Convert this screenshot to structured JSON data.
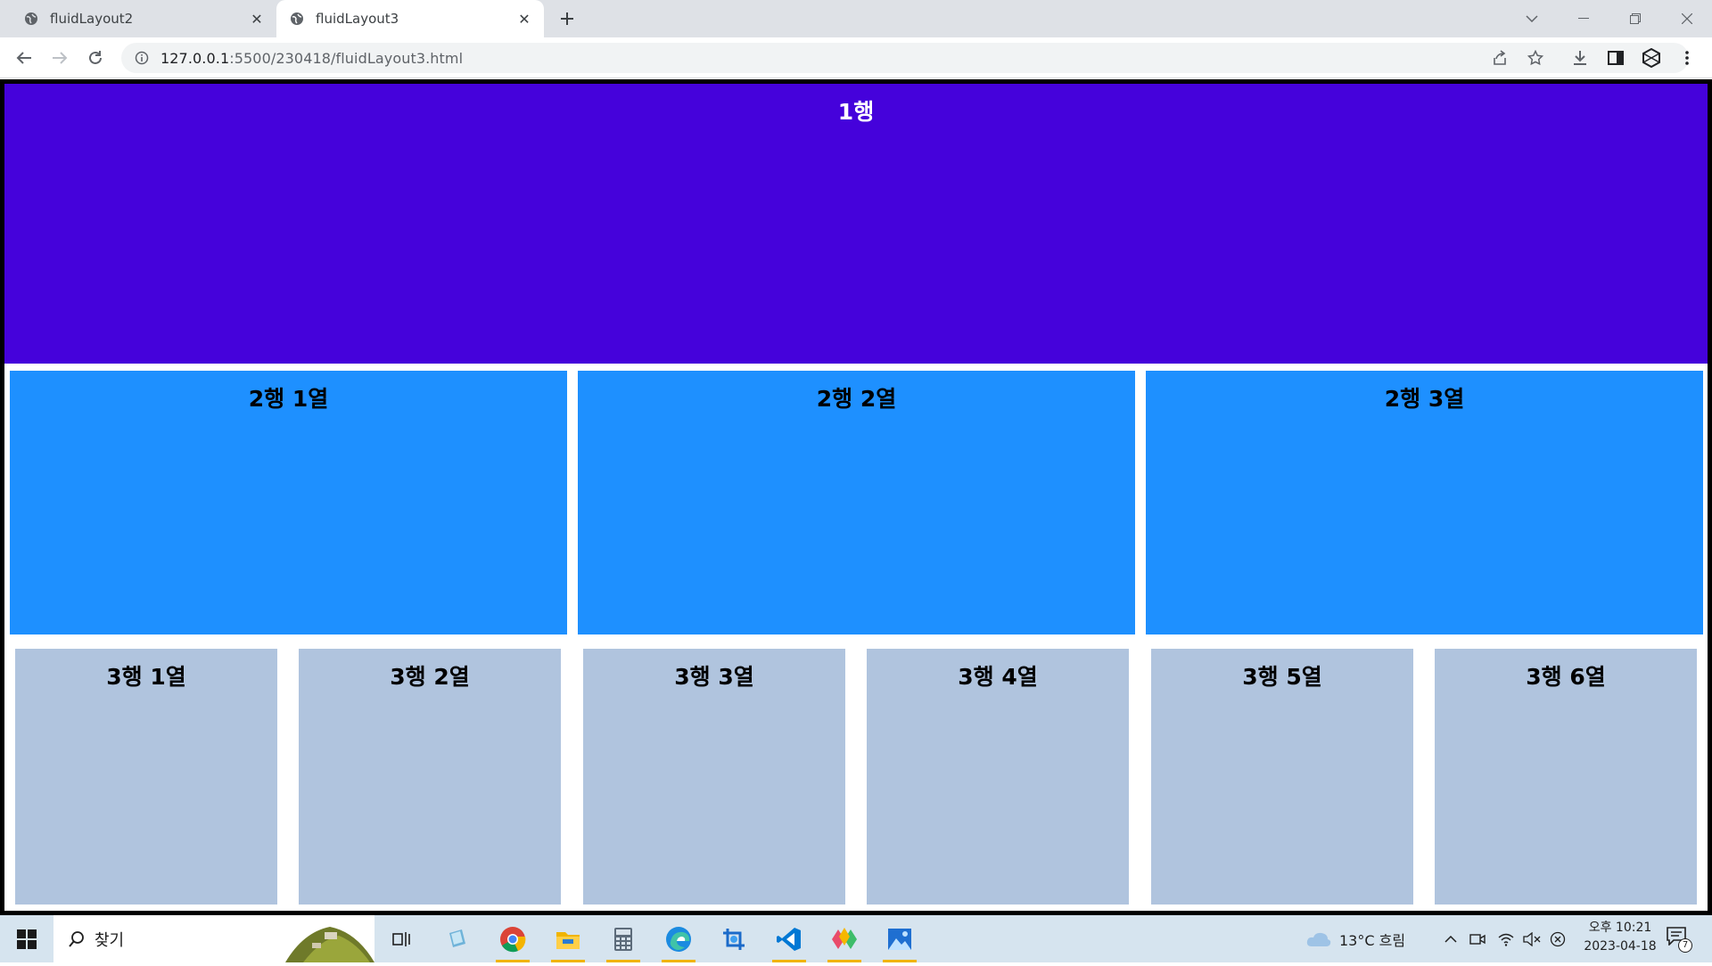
{
  "browser": {
    "tabs": [
      {
        "title": "fluidLayout2",
        "active": false
      },
      {
        "title": "fluidLayout3",
        "active": true
      }
    ],
    "url_host": "127.0.0.1",
    "url_rest": ":5500/230418/fluidLayout3.html"
  },
  "page": {
    "row1": {
      "label": "1행",
      "color": "#4502db"
    },
    "row2": {
      "color": "#1e90ff",
      "cells": [
        "2행 1열",
        "2행 2열",
        "2행 3열"
      ]
    },
    "row3": {
      "color": "#b0c4de",
      "cells": [
        "3행 1열",
        "3행 2열",
        "3행 3열",
        "3행 4열",
        "3행 5열",
        "3행 6열"
      ]
    }
  },
  "taskbar": {
    "search_text": "찾기",
    "weather": "13°C 흐림",
    "time": "오후 10:21",
    "date": "2023-04-18",
    "notification_count": "7"
  }
}
